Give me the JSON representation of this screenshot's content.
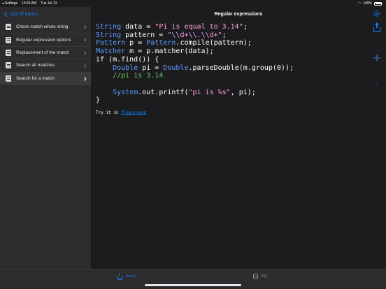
{
  "status_bar": {
    "back_app": "◂ Settings",
    "time": "10:26 AM",
    "date": "Tue Jul 13",
    "battery": "100%"
  },
  "sidebar": {
    "back_label": "List of topics",
    "items": [
      {
        "label": "Check match whole string",
        "selected": false
      },
      {
        "label": "Regular expression options",
        "selected": false
      },
      {
        "label": "Replacement of the match",
        "selected": false
      },
      {
        "label": "Search all matches",
        "selected": false
      },
      {
        "label": "Search for a match",
        "selected": true
      }
    ]
  },
  "header": {
    "title": "Regular expressions"
  },
  "code": {
    "lines": [
      "String data = \"Pi is equal to 3.14\";",
      "String pattern = \"\\\\d+\\\\.\\\\d+\";",
      "Pattern p = Pattern.compile(pattern);",
      "Matcher m = p.matcher(data);",
      "if (m.find()) {",
      "    Double pi = Double.parseDouble(m.group(0));",
      "    //pi is 3.14",
      "",
      "    System.out.printf(\"pi is %s\", pi);",
      "}"
    ]
  },
  "try_it": {
    "prefix": "Try it in",
    "link_label": "Playground"
  },
  "tabbar": {
    "tabs": [
      {
        "label": "Java 8",
        "icon": "coffee-icon",
        "active": true
      },
      {
        "label": "SQL",
        "icon": "database-icon",
        "active": false
      }
    ]
  },
  "colors": {
    "accent": "#0a84ff",
    "background": "#1c1c1e",
    "sidebar": "#2c2c2e",
    "keyword_type": "#5e9bff",
    "string": "#ff9fd0",
    "comment": "#66cc66"
  }
}
